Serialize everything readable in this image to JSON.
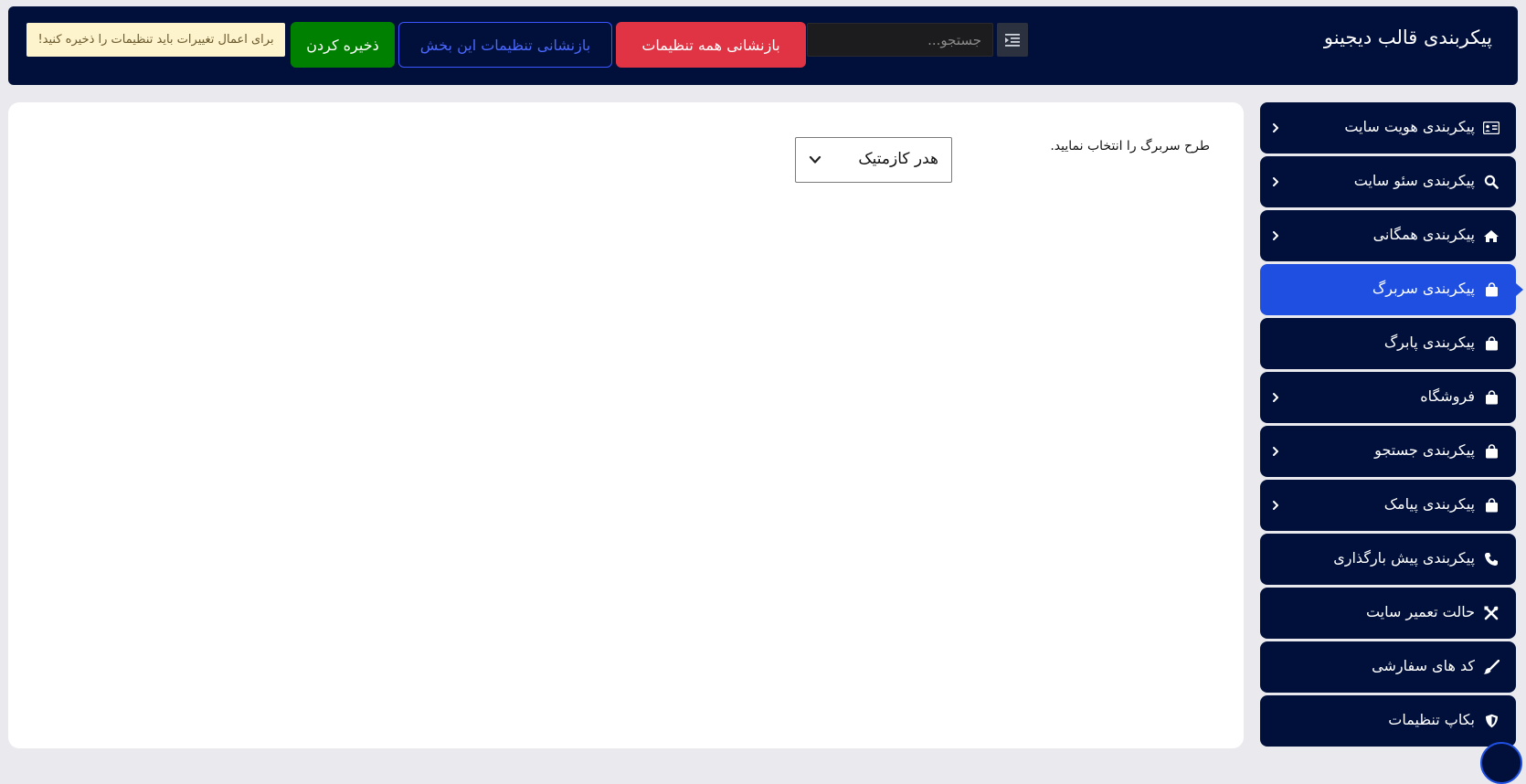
{
  "header": {
    "title": "پیکربندی قالب دیجینو",
    "menu_toggle_icon": "indent-list-icon",
    "search_placeholder": "جستجو...",
    "reset_all_label": "بازنشانی همه تنظیمات",
    "reset_section_label": "بازنشانی تنظیمات این بخش",
    "save_label": "ذخیره کردن",
    "notice": "برای اعمال تغییرات باید تنظیمات را ذخیره کنید!"
  },
  "colors": {
    "navy": "#00103a",
    "active": "#1e4fe0",
    "danger": "#e03344",
    "success": "#008000",
    "outline_blue": "#3b55ff",
    "notice_bg": "#fdf3cd"
  },
  "main": {
    "field_label": "طرح سربرگ را انتخاب نمایید.",
    "select_value": "هدر کازمتیک"
  },
  "sidebar": {
    "items": [
      {
        "label": "پیکربندی هویت سایت",
        "icon": "id-card-icon",
        "has_submenu": true
      },
      {
        "label": "پیکربندی سئو سایت",
        "icon": "search-icon",
        "has_submenu": true
      },
      {
        "label": "پیکربندی همگانی",
        "icon": "home-icon",
        "has_submenu": true
      },
      {
        "label": "پیکربندی سربرگ",
        "icon": "shopping-bag-icon",
        "has_submenu": false,
        "active": true
      },
      {
        "label": "پیکربندی پابرگ",
        "icon": "shopping-bag-icon",
        "has_submenu": false
      },
      {
        "label": "فروشگاه",
        "icon": "shopping-bag-icon",
        "has_submenu": true
      },
      {
        "label": "پیکربندی جستجو",
        "icon": "shopping-bag-icon",
        "has_submenu": true
      },
      {
        "label": "پیکربندی پیامک",
        "icon": "shopping-bag-icon",
        "has_submenu": true
      },
      {
        "label": "پیکربندی پیش بارگذاری",
        "icon": "phone-icon",
        "has_submenu": false
      },
      {
        "label": "حالت تعمیر سایت",
        "icon": "tools-icon",
        "has_submenu": false
      },
      {
        "label": "کد های سفارشی",
        "icon": "brush-icon",
        "has_submenu": false
      },
      {
        "label": "بکاپ تنظیمات",
        "icon": "shield-icon",
        "has_submenu": false
      }
    ]
  }
}
